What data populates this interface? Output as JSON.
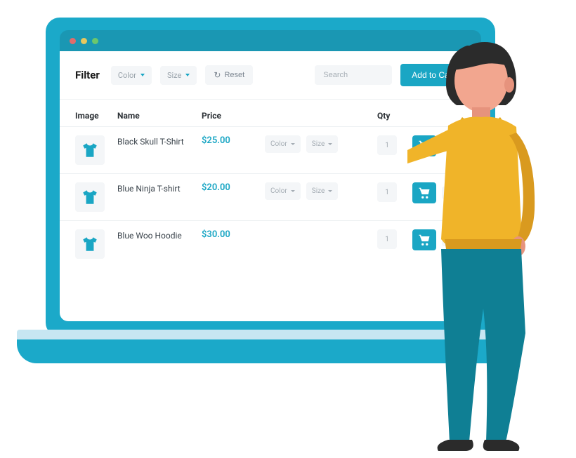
{
  "filter": {
    "label": "Filter",
    "color_dd": "Color",
    "size_dd": "Size",
    "reset": "Reset",
    "search_placeholder": "Search",
    "add_to_cart": "Add to Cart"
  },
  "columns": {
    "image": "Image",
    "name": "Name",
    "price": "Price",
    "qty": "Qty"
  },
  "option_labels": {
    "color": "Color",
    "size": "Size"
  },
  "products": [
    {
      "name": "Black Skull T-Shirt",
      "price": "$25.00",
      "qty": "1",
      "has_options": true
    },
    {
      "name": "Blue Ninja T-shirt",
      "price": "$20.00",
      "qty": "1",
      "has_options": true
    },
    {
      "name": "Blue Woo Hoodie",
      "price": "$30.00",
      "qty": "1",
      "has_options": false
    }
  ],
  "colors": {
    "accent": "#1aa6c4",
    "frame": "#1ba9c9"
  }
}
